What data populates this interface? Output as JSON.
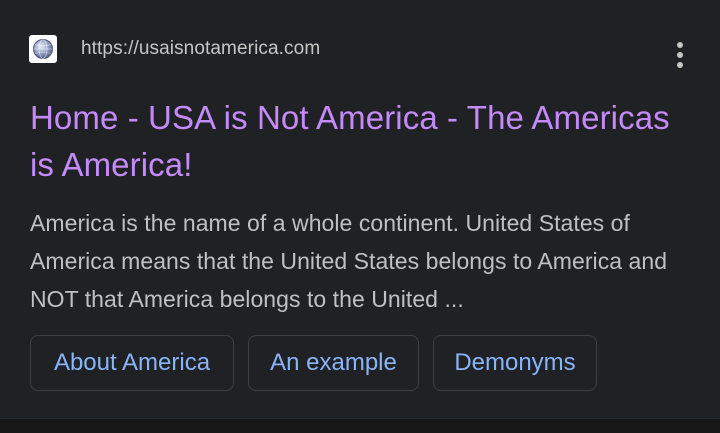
{
  "result": {
    "url": "https://usaisnotamerica.com",
    "favicon_icon": "globe-icon",
    "menu_icon": "more-vert-icon",
    "title": "Home - USA is Not America - The Americas is America!",
    "snippet": "America is the name of a whole continent. United States of America means that the United States belongs to America and NOT that America belongs to the United ...",
    "sitelinks": [
      {
        "label": "About America"
      },
      {
        "label": "An example"
      },
      {
        "label": "Demonyms"
      }
    ]
  },
  "colors": {
    "background": "#202124",
    "title_visited": "#c58af9",
    "url_text": "#c4c7c5",
    "snippet_text": "#bdc1c6",
    "sitelink_text": "#8ab4f8",
    "chip_border": "#3c4043"
  }
}
